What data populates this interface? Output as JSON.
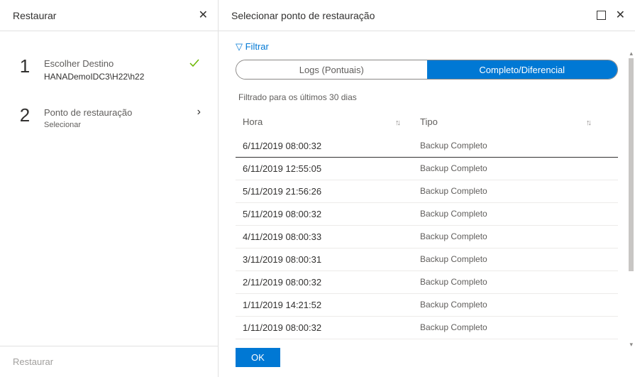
{
  "left_panel": {
    "title": "Restaurar",
    "steps": [
      {
        "num": "1",
        "title": "Escolher Destino",
        "sub": "HANADemoIDC3\\H22\\h22",
        "status": "done"
      },
      {
        "num": "2",
        "title": "Ponto de restauração",
        "sub": "Selecionar",
        "status": "current"
      }
    ],
    "footer_label": "Restaurar"
  },
  "right_panel": {
    "title": "Selecionar ponto de restauração",
    "filter_link": "▽ Filtrar",
    "tabs": {
      "logs": "Logs (Pontuais)",
      "full": "Completo/Diferencial"
    },
    "filter_text": "Filtrado para os últimos 30 dias",
    "columns": {
      "hora": "Hora",
      "tipo": "Tipo"
    },
    "rows": [
      {
        "hora": "6/11/2019 08:00:32",
        "tipo": "Backup Completo",
        "selected": true
      },
      {
        "hora": "6/11/2019 12:55:05",
        "tipo": "Backup Completo"
      },
      {
        "hora": "5/11/2019 21:56:26",
        "tipo": "Backup Completo"
      },
      {
        "hora": "5/11/2019 08:00:32",
        "tipo": "Backup Completo"
      },
      {
        "hora": "4/11/2019 08:00:33",
        "tipo": "Backup Completo"
      },
      {
        "hora": "3/11/2019 08:00:31",
        "tipo": "Backup Completo"
      },
      {
        "hora": "2/11/2019 08:00:32",
        "tipo": "Backup Completo"
      },
      {
        "hora": "1/11/2019 14:21:52",
        "tipo": "Backup Completo"
      },
      {
        "hora": "1/11/2019 08:00:32",
        "tipo": "Backup Completo"
      }
    ],
    "ok_label": "OK"
  }
}
